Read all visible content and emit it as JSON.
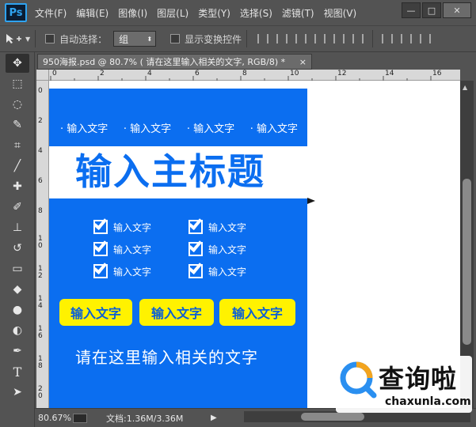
{
  "app": {
    "logo": "Ps"
  },
  "menu": [
    "文件(F)",
    "编辑(E)",
    "图像(I)",
    "图层(L)",
    "类型(Y)",
    "选择(S)",
    "滤镜(T)",
    "视图(V)"
  ],
  "window_controls": {
    "minimize": "—",
    "maximize": "□",
    "close": "✕"
  },
  "options": {
    "auto_select_label": "自动选择：",
    "auto_select_value": "组",
    "show_transform_label": "显示变换控件"
  },
  "document": {
    "tab_title": "950海报.psd @ 80.7% (    请在这里输入相关的文字, RGB/8) *",
    "tab_close": "×"
  },
  "ruler": {
    "top_labels": [
      "0",
      "2",
      "4",
      "6",
      "8",
      "10",
      "12",
      "14",
      "16"
    ],
    "left_labels": [
      "0",
      "2",
      "4",
      "6",
      "8",
      "1\n0",
      "1\n2",
      "1\n4",
      "1\n6",
      "1\n8",
      "2\n0"
    ]
  },
  "poster": {
    "top_labels": [
      "· 输入文字",
      "· 输入文字",
      "· 输入文字",
      "· 输入文字"
    ],
    "main_title": "输入主标题",
    "check_items": [
      "输入文字",
      "输入文字",
      "输入文字",
      "输入文字",
      "输入文字",
      "输入文字"
    ],
    "yellow_buttons": [
      "输入文字",
      "输入文字",
      "输入文字"
    ],
    "bottom_text": "请在这里输入相关的文字",
    "colors": {
      "blue": "#0b6ef0",
      "yellow": "#fff200",
      "white": "#ffffff"
    }
  },
  "status": {
    "zoom": "80.67%",
    "doc_info": "文档:1.36M/3.36M",
    "arrow": "▶"
  },
  "watermark": {
    "cn": "查询啦",
    "en": "chaxunla.com"
  }
}
